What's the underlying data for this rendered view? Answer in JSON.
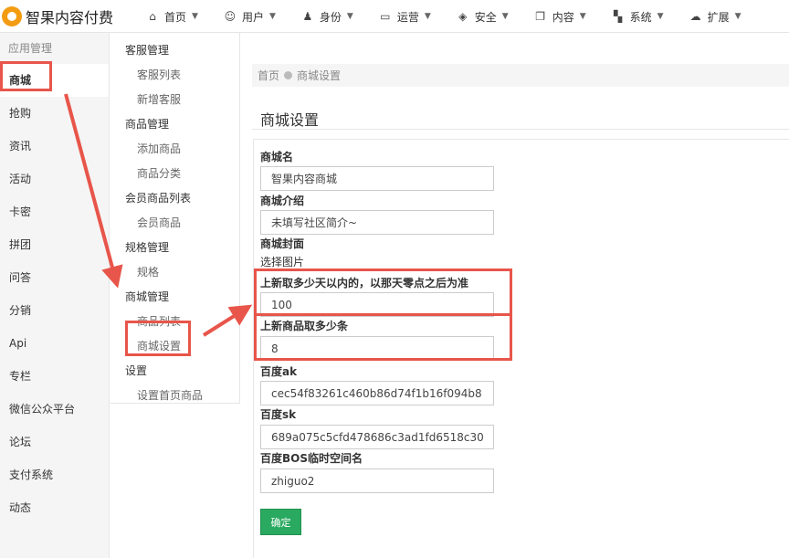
{
  "app": {
    "title": "智果内容付费"
  },
  "topnav": [
    {
      "label": "首页",
      "icon": "home-icon",
      "glyph": "⌂"
    },
    {
      "label": "用户",
      "icon": "user-icon",
      "glyph": "☺"
    },
    {
      "label": "身份",
      "icon": "users-icon",
      "glyph": "♟"
    },
    {
      "label": "运营",
      "icon": "monitor-icon",
      "glyph": "▭"
    },
    {
      "label": "安全",
      "icon": "shield-icon",
      "glyph": "◈"
    },
    {
      "label": "内容",
      "icon": "copy-icon",
      "glyph": "❐"
    },
    {
      "label": "系统",
      "icon": "windows-icon",
      "glyph": "▚"
    },
    {
      "label": "扩展",
      "icon": "cloud-icon",
      "glyph": "☁"
    }
  ],
  "sidebar": {
    "section": "应用管理",
    "items": [
      {
        "label": "商城",
        "active": true
      },
      {
        "label": "抢购"
      },
      {
        "label": "资讯"
      },
      {
        "label": "活动"
      },
      {
        "label": "卡密"
      },
      {
        "label": "拼团"
      },
      {
        "label": "问答"
      },
      {
        "label": "分销"
      },
      {
        "label": "Api"
      },
      {
        "label": "专栏"
      },
      {
        "label": "微信公众平台"
      },
      {
        "label": "论坛"
      },
      {
        "label": "支付系统"
      },
      {
        "label": "动态"
      }
    ]
  },
  "submenu": {
    "g1": "客服管理",
    "g1a": "客服列表",
    "g1b": "新增客服",
    "g2": "商品管理",
    "g2a": "添加商品",
    "g2b": "商品分类",
    "g3": "会员商品列表",
    "g3a": "会员商品",
    "g4": "规格管理",
    "g4a": "规格",
    "g5": "商城管理",
    "g5a": "商品列表",
    "g5b": "商城设置",
    "g6": "设置",
    "g6a": "设置首页商品"
  },
  "breadcrumb": {
    "home": "首页",
    "current": "商城设置"
  },
  "page": {
    "title": "商城设置"
  },
  "form": {
    "shop_name_label": "商城名",
    "shop_name_value": "智果内容商城",
    "shop_intro_label": "商城介绍",
    "shop_intro_value": "未填写社区简介~",
    "shop_cover_label": "商城封面",
    "shop_cover_link": "选择图片",
    "new_days_label": "上新取多少天以内的，以那天零点之后为准",
    "new_days_value": "100",
    "new_count_label": "上新商品取多少条",
    "new_count_value": "8",
    "baidu_ak_label": "百度ak",
    "baidu_ak_value": "cec54f83261c460b86d74f1b16f094b8",
    "baidu_sk_label": "百度sk",
    "baidu_sk_value": "689a075c5cfd478686c3ad1fd6518c30",
    "bos_label": "百度BOS临时空间名",
    "bos_value": "zhiguo2",
    "confirm_label": "确定"
  },
  "colors": {
    "annotation": "#e8554a",
    "confirm": "#2aa960",
    "brand": "#f39c12"
  }
}
